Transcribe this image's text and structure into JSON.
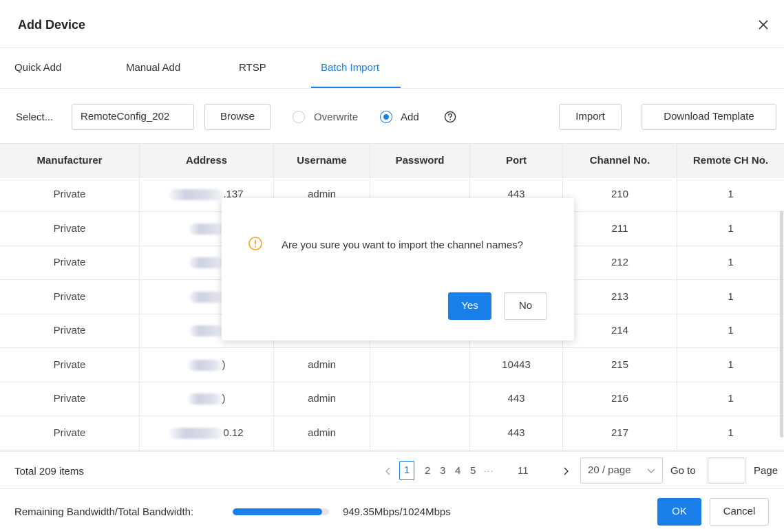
{
  "dialog": {
    "title": "Add Device",
    "close_icon": "close-icon"
  },
  "tabs": [
    {
      "label": "Quick Add",
      "active": false
    },
    {
      "label": "Manual Add",
      "active": false
    },
    {
      "label": "RTSP",
      "active": false
    },
    {
      "label": "Batch Import",
      "active": true
    }
  ],
  "toolbar": {
    "select_label": "Select...",
    "file_value": "RemoteConfig_202",
    "browse_label": "Browse",
    "overwrite_label": "Overwrite",
    "overwrite_checked": false,
    "add_label": "Add",
    "add_checked": true,
    "help_icon": "question-circle-icon",
    "import_label": "Import",
    "download_label": "Download Template"
  },
  "table": {
    "columns": [
      "Manufacturer",
      "Address",
      "Username",
      "Password",
      "Port",
      "Channel No.",
      "Remote CH No."
    ],
    "rows": [
      {
        "manufacturer": "Private",
        "address": ".137",
        "username": "admin",
        "password": "",
        "port": "443",
        "channel": "210",
        "remote": "1"
      },
      {
        "manufacturer": "Private",
        "address": "",
        "username": "",
        "password": "",
        "port": "",
        "channel": "211",
        "remote": "1"
      },
      {
        "manufacturer": "Private",
        "address": "",
        "username": "",
        "password": "",
        "port": "",
        "channel": "212",
        "remote": "1"
      },
      {
        "manufacturer": "Private",
        "address": "",
        "username": "",
        "password": "",
        "port": "",
        "channel": "213",
        "remote": "1"
      },
      {
        "manufacturer": "Private",
        "address": "",
        "username": "",
        "password": "",
        "port": "",
        "channel": "214",
        "remote": "1"
      },
      {
        "manufacturer": "Private",
        "address": ")",
        "username": "admin",
        "password": "",
        "port": "10443",
        "channel": "215",
        "remote": "1"
      },
      {
        "manufacturer": "Private",
        "address": ")",
        "username": "admin",
        "password": "",
        "port": "443",
        "channel": "216",
        "remote": "1"
      },
      {
        "manufacturer": "Private",
        "address": "0.12",
        "username": "admin",
        "password": "",
        "port": "443",
        "channel": "217",
        "remote": "1"
      }
    ]
  },
  "pagination": {
    "total": "Total 209 items",
    "prev_icon": "chevron-left-icon",
    "next_icon": "chevron-right-icon",
    "pages": [
      "1",
      "2",
      "3",
      "4",
      "5"
    ],
    "ellipsis": "···",
    "last_page": "11",
    "current_page": "1",
    "page_size": "20 / page",
    "goto_label": "Go to",
    "page_label": "Page"
  },
  "footer": {
    "bandwidth_label": "Remaining Bandwidth/Total Bandwidth:",
    "bandwidth_value": "949.35Mbps/1024Mbps",
    "bandwidth_fraction": 0.927,
    "ok_label": "OK",
    "cancel_label": "Cancel"
  },
  "confirm": {
    "icon": "exclamation-circle-icon",
    "message": "Are you sure you want to import the channel names?",
    "yes_label": "Yes",
    "no_label": "No"
  },
  "colors": {
    "accent": "#1a7fe8",
    "warning": "#f5a623"
  }
}
